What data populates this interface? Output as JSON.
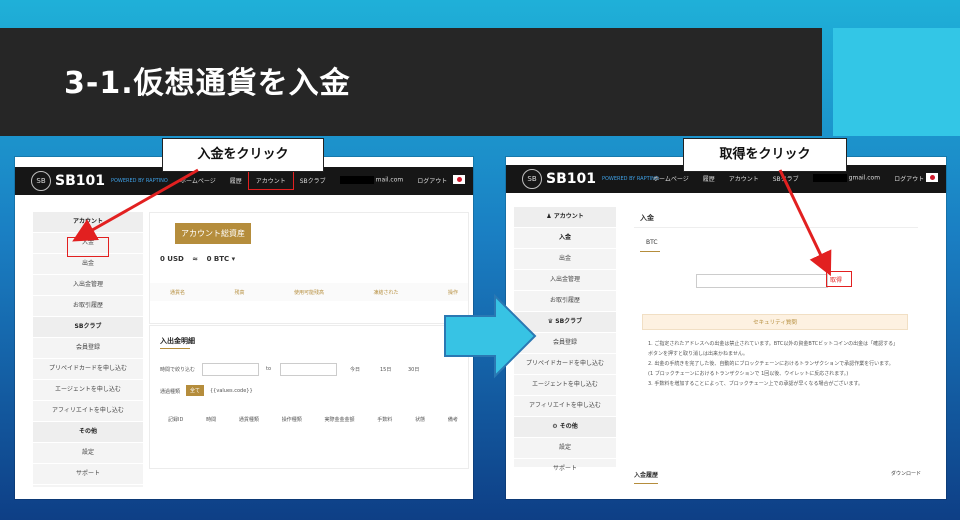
{
  "slide": {
    "title": "3-1.仮想通貨を入金"
  },
  "callouts": {
    "left": "入金をクリック",
    "right": "取得をクリック"
  },
  "left_screen": {
    "logo": {
      "mark": "SB",
      "text": "SB101",
      "sub": "POWERED BY RAPTINO"
    },
    "nav": {
      "home": "ホームページ",
      "history": "履歴",
      "account": "アカウント",
      "club": "SBクラブ",
      "email": "mail.com",
      "logout": "ログアウト"
    },
    "sidebar": [
      {
        "label": "アカウント",
        "head": true
      },
      {
        "label": "入金"
      },
      {
        "label": "出金"
      },
      {
        "label": "入出金管理"
      },
      {
        "label": "お取引履歴"
      },
      {
        "label": "SBクラブ",
        "head": true
      },
      {
        "label": "会員登録"
      },
      {
        "label": "プリペイドカードを申し込む"
      },
      {
        "label": "エージェントを申し込む"
      },
      {
        "label": "アフィリエイトを申し込む"
      },
      {
        "label": "その他",
        "head": true
      },
      {
        "label": "設定"
      },
      {
        "label": "サポート"
      }
    ],
    "assets": {
      "badge": "アカウント総資産",
      "usd": "0 USD",
      "approx": "≈",
      "btc": "0 BTC ▾"
    },
    "asset_table_headers": [
      "通貨名",
      "残高",
      "使用可能残高",
      "凍結された",
      "操作"
    ],
    "history": {
      "title": "入出金明細",
      "time_label": "時間で絞り込む",
      "to": "to",
      "ranges": [
        "今日",
        "15日",
        "30日"
      ],
      "type_label": "通過種類",
      "type_all": "全て",
      "type_token": "{{values.code}}",
      "columns": [
        "記録ID",
        "時間",
        "通貨種類",
        "操作種類",
        "実際金金金額",
        "手数料",
        "状態",
        "備考"
      ]
    }
  },
  "right_screen": {
    "logo": {
      "mark": "SB",
      "text": "SB101",
      "sub": "POWERED BY RAPTINO"
    },
    "nav": {
      "home": "ホームページ",
      "history": "履歴",
      "account": "アカウント",
      "club": "SBクラブ",
      "email": "gmail.com",
      "logout": "ログアウト"
    },
    "sidebar": [
      {
        "label": "アカウント",
        "head": true,
        "icon": "user-icon"
      },
      {
        "label": "入金",
        "active": true
      },
      {
        "label": "出金"
      },
      {
        "label": "入出金管理"
      },
      {
        "label": "お取引履歴"
      },
      {
        "label": "SBクラブ",
        "head": true,
        "icon": "crown-icon"
      },
      {
        "label": "会員登録"
      },
      {
        "label": "プリペイドカードを申し込む"
      },
      {
        "label": "エージェントを申し込む"
      },
      {
        "label": "アフィリエイトを申し込む"
      },
      {
        "label": "その他",
        "head": true,
        "icon": "gear-icon"
      },
      {
        "label": "設定"
      },
      {
        "label": "サポート"
      }
    ],
    "deposit": {
      "title": "入金",
      "tab": "BTC",
      "get_button": "取得",
      "security_title": "セキュリティ質問",
      "notes": [
        "1. ご指定されたアドレスへの出金は禁止されています。BTC以外の資金BTCビットコインの出金は「確認する」ボタンを押すと取り消しは出来かねません。",
        "2. 出金の手続きを完了した後、自動的にブロックチェーンにおけるトランザクションで承認作業を行います。",
        "(1 ブロックチェーンにおけるトランザクションで 1回以後、ウイレットに反応されます。)",
        "3. 手数料を増加することによって、ブロックチェーン上での承認が早くなる場合がございます。"
      ],
      "history_title": "入金履歴",
      "download": "ダウンロード"
    }
  },
  "colors": {
    "accent_red": "#e22020",
    "gold": "#b58d3c",
    "cyan": "#33c6e6",
    "title_bg": "#262626"
  }
}
